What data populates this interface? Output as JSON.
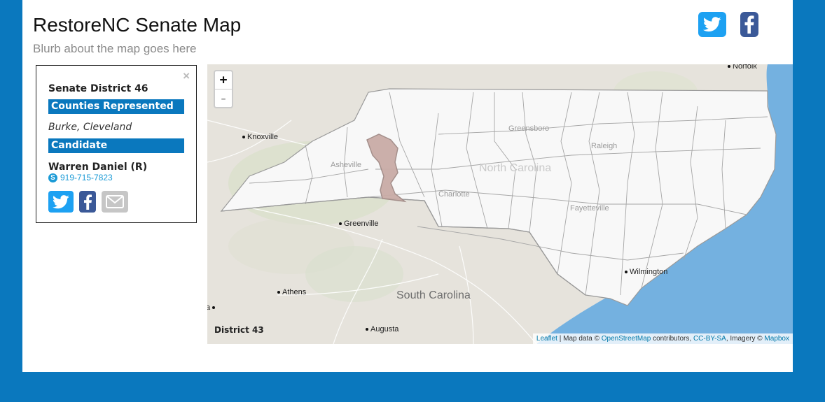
{
  "header": {
    "title": "RestoreNC Senate Map",
    "blurb": "Blurb about the map goes here",
    "share_twitter_icon": "twitter-icon",
    "share_facebook_icon": "facebook-icon"
  },
  "panel": {
    "close_label": "×",
    "district_title": "Senate District 46",
    "counties_heading": "Counties Represented",
    "counties": "Burke, Cleveland",
    "candidate_heading": "Candidate",
    "candidate_name": "Warren Daniel (R)",
    "phone": "919-715-7823",
    "contact_icons": [
      "twitter-icon",
      "facebook-icon",
      "mail-icon"
    ]
  },
  "map": {
    "zoom_in_label": "+",
    "zoom_out_label": "-",
    "hover_district": "District 43",
    "state_label": "North Carolina",
    "neighbor_state_label": "South Carolina",
    "cities": [
      {
        "name": "Norfolk",
        "kind": "major"
      },
      {
        "name": "Knoxville",
        "kind": "major"
      },
      {
        "name": "Greenville",
        "kind": "major"
      },
      {
        "name": "Athens",
        "kind": "major"
      },
      {
        "name": "Augusta",
        "kind": "major"
      },
      {
        "name": "Wilmington",
        "kind": "major"
      },
      {
        "name": "a",
        "kind": "major"
      },
      {
        "name": "Asheville",
        "kind": "faint"
      },
      {
        "name": "Greensboro",
        "kind": "faint"
      },
      {
        "name": "Raleigh",
        "kind": "faint"
      },
      {
        "name": "Charlotte",
        "kind": "faint"
      },
      {
        "name": "Fayetteville",
        "kind": "faint"
      }
    ],
    "highlight_color": "#c9aca6",
    "water_color": "#74b1e0",
    "district_fill": "#f8f8f8",
    "attribution": {
      "leaflet": "Leaflet",
      "map_data_prefix": " | Map data © ",
      "osm": "OpenStreetMap",
      "contributors": " contributors, ",
      "license": "CC-BY-SA",
      "imagery": ", Imagery © ",
      "mapbox": "Mapbox"
    }
  }
}
